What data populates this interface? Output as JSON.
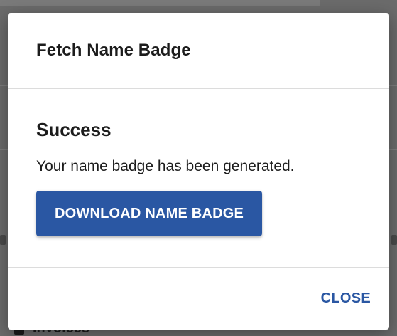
{
  "dialog": {
    "title": "Fetch Name Badge",
    "heading": "Success",
    "message": "Your name badge has been generated.",
    "download_label": "DOWNLOAD NAME BADGE",
    "close_label": "CLOSE"
  },
  "background": {
    "nav_item_label": "Invoices"
  },
  "colors": {
    "primary": "#2a57a3",
    "backdrop": "#6b6b6b",
    "text": "#1c1c1c"
  }
}
